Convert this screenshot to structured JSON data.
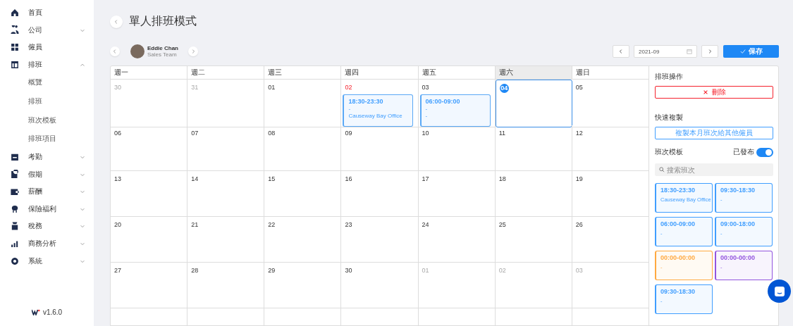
{
  "sidebar": {
    "items": [
      {
        "label": "首頁",
        "expandable": false
      },
      {
        "label": "公司",
        "expandable": true,
        "expanded": false
      },
      {
        "label": "僱員",
        "expandable": false
      },
      {
        "label": "排班",
        "expandable": true,
        "expanded": true,
        "children": [
          {
            "label": "概覽"
          },
          {
            "label": "排班"
          },
          {
            "label": "班次模板"
          },
          {
            "label": "排班項目"
          }
        ]
      },
      {
        "label": "考勤",
        "expandable": true,
        "expanded": false
      },
      {
        "label": "假期",
        "expandable": true,
        "expanded": false
      },
      {
        "label": "薪酬",
        "expandable": true,
        "expanded": false
      },
      {
        "label": "保險福利",
        "expandable": true,
        "expanded": false
      },
      {
        "label": "稅務",
        "expandable": true,
        "expanded": false
      },
      {
        "label": "商務分析",
        "expandable": true,
        "expanded": false
      },
      {
        "label": "系統",
        "expandable": true,
        "expanded": false
      }
    ],
    "version": "v1.6.0"
  },
  "page": {
    "title": "單人排班模式"
  },
  "employee": {
    "name": "Eddie Chan",
    "team": "Sales Team"
  },
  "month_picker": {
    "value": "2021-09"
  },
  "save_button": "保存",
  "calendar": {
    "weekdays": [
      {
        "label": "週一",
        "highlighted": false
      },
      {
        "label": "週二",
        "highlighted": false
      },
      {
        "label": "週三",
        "highlighted": false
      },
      {
        "label": "週四",
        "highlighted": false
      },
      {
        "label": "週五",
        "highlighted": false
      },
      {
        "label": "週六",
        "highlighted": true
      },
      {
        "label": "週日",
        "highlighted": false
      }
    ],
    "weeks": [
      [
        {
          "day": "30",
          "muted": true,
          "holiday": false,
          "selected": false
        },
        {
          "day": "31",
          "muted": true,
          "holiday": false,
          "selected": false
        },
        {
          "day": "01",
          "muted": false,
          "holiday": false,
          "selected": false
        },
        {
          "day": "02",
          "muted": false,
          "holiday": true,
          "selected": false,
          "shifts": [
            {
              "time": "18:30-23:30",
              "lines": [
                "-",
                "Causeway Bay Office"
              ]
            }
          ]
        },
        {
          "day": "03",
          "muted": false,
          "holiday": false,
          "selected": false,
          "shifts": [
            {
              "time": "06:00-09:00",
              "lines": [
                "-",
                "-"
              ]
            }
          ]
        },
        {
          "day": "04",
          "muted": false,
          "holiday": false,
          "selected": true
        },
        {
          "day": "05",
          "muted": false,
          "holiday": false,
          "selected": false
        }
      ],
      [
        {
          "day": "06",
          "muted": false,
          "holiday": false,
          "selected": false
        },
        {
          "day": "07",
          "muted": false,
          "holiday": false,
          "selected": false
        },
        {
          "day": "08",
          "muted": false,
          "holiday": false,
          "selected": false
        },
        {
          "day": "09",
          "muted": false,
          "holiday": false,
          "selected": false
        },
        {
          "day": "10",
          "muted": false,
          "holiday": false,
          "selected": false
        },
        {
          "day": "11",
          "muted": false,
          "holiday": false,
          "selected": false
        },
        {
          "day": "12",
          "muted": false,
          "holiday": false,
          "selected": false
        }
      ],
      [
        {
          "day": "13",
          "muted": false,
          "holiday": false,
          "selected": false
        },
        {
          "day": "14",
          "muted": false,
          "holiday": false,
          "selected": false
        },
        {
          "day": "15",
          "muted": false,
          "holiday": false,
          "selected": false
        },
        {
          "day": "16",
          "muted": false,
          "holiday": false,
          "selected": false
        },
        {
          "day": "17",
          "muted": false,
          "holiday": false,
          "selected": false
        },
        {
          "day": "18",
          "muted": false,
          "holiday": false,
          "selected": false
        },
        {
          "day": "19",
          "muted": false,
          "holiday": false,
          "selected": false
        }
      ],
      [
        {
          "day": "20",
          "muted": false,
          "holiday": false,
          "selected": false
        },
        {
          "day": "21",
          "muted": false,
          "holiday": false,
          "selected": false
        },
        {
          "day": "22",
          "muted": false,
          "holiday": false,
          "selected": false
        },
        {
          "day": "23",
          "muted": false,
          "holiday": false,
          "selected": false
        },
        {
          "day": "24",
          "muted": false,
          "holiday": false,
          "selected": false
        },
        {
          "day": "25",
          "muted": false,
          "holiday": false,
          "selected": false
        },
        {
          "day": "26",
          "muted": false,
          "holiday": false,
          "selected": false
        }
      ],
      [
        {
          "day": "27",
          "muted": false,
          "holiday": false,
          "selected": false
        },
        {
          "day": "28",
          "muted": false,
          "holiday": false,
          "selected": false
        },
        {
          "day": "29",
          "muted": false,
          "holiday": false,
          "selected": false
        },
        {
          "day": "30",
          "muted": false,
          "holiday": false,
          "selected": false
        },
        {
          "day": "01",
          "muted": true,
          "holiday": false,
          "selected": false
        },
        {
          "day": "02",
          "muted": true,
          "holiday": false,
          "selected": false
        },
        {
          "day": "03",
          "muted": true,
          "holiday": false,
          "selected": false
        }
      ]
    ]
  },
  "panel": {
    "operations_title": "排班操作",
    "delete_button": "刪除",
    "copy_title": "快速複製",
    "copy_button": "複製本月班次給其他僱員",
    "templates_title": "班次模板",
    "published_label": "已發布",
    "published": true,
    "search": {
      "placeholder": "搜索班次"
    },
    "templates": [
      {
        "time": "18:30-23:30",
        "note": "Causeway Bay Office",
        "color": "#409eff"
      },
      {
        "time": "09:30-18:30",
        "note": "-",
        "color": "#409eff"
      },
      {
        "time": "06:00-09:00",
        "note": "-",
        "color": "#409eff"
      },
      {
        "time": "09:00-18:00",
        "note": "-",
        "color": "#409eff"
      },
      {
        "time": "00:00-00:00",
        "note": "-",
        "color": "#ffa940"
      },
      {
        "time": "00:00-00:00",
        "note": "-",
        "color": "#9254de"
      },
      {
        "time": "09:30-18:30",
        "note": "-",
        "color": "#409eff"
      }
    ]
  }
}
